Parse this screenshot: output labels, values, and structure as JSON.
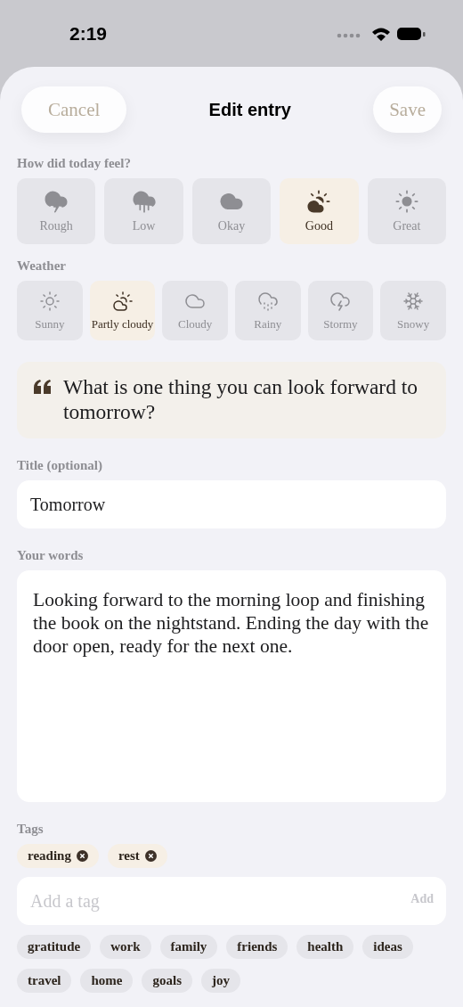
{
  "status_bar": {
    "time": "2:19"
  },
  "header": {
    "title": "Edit entry",
    "cancel": {
      "label": "Cancel",
      "disabled": true
    },
    "save": {
      "label": "Save",
      "disabled": true
    }
  },
  "mood": {
    "label": "How did today feel?",
    "options": [
      {
        "label": "Rough",
        "kind": "storm",
        "selected": false
      },
      {
        "label": "Low",
        "kind": "rain",
        "selected": false
      },
      {
        "label": "Okay",
        "kind": "cloud",
        "selected": false
      },
      {
        "label": "Good",
        "kind": "partly",
        "selected": true
      },
      {
        "label": "Great",
        "kind": "sun",
        "selected": false
      }
    ]
  },
  "weather": {
    "label": "Weather",
    "options": [
      {
        "label": "Sunny",
        "kind": "sun",
        "selected": false
      },
      {
        "label": "Partly cloudy",
        "kind": "partly",
        "selected": true
      },
      {
        "label": "Cloudy",
        "kind": "cloud",
        "selected": false
      },
      {
        "label": "Rainy",
        "kind": "rain",
        "selected": false
      },
      {
        "label": "Stormy",
        "kind": "storm",
        "selected": false
      },
      {
        "label": "Snowy",
        "kind": "snow",
        "selected": false
      }
    ]
  },
  "prompt": {
    "text": "What is one thing you can look forward to tomorrow?"
  },
  "title_field": {
    "label": "Title (optional)",
    "value": "Tomorrow"
  },
  "words": {
    "label": "Your words",
    "value": "Looking forward to the morning loop and finishing the book on the nightstand. Ending the day with the door open, ready for the next one."
  },
  "tags": {
    "label": "Tags",
    "chosen": [
      {
        "label": "reading"
      },
      {
        "label": "rest"
      }
    ],
    "input": {
      "placeholder": "Add a tag",
      "button": "Add"
    },
    "suggestions": [
      {
        "label": "gratitude"
      },
      {
        "label": "work"
      },
      {
        "label": "family"
      },
      {
        "label": "friends"
      },
      {
        "label": "health"
      },
      {
        "label": "ideas"
      },
      {
        "label": "travel"
      },
      {
        "label": "home"
      },
      {
        "label": "goals"
      },
      {
        "label": "joy"
      }
    ]
  }
}
